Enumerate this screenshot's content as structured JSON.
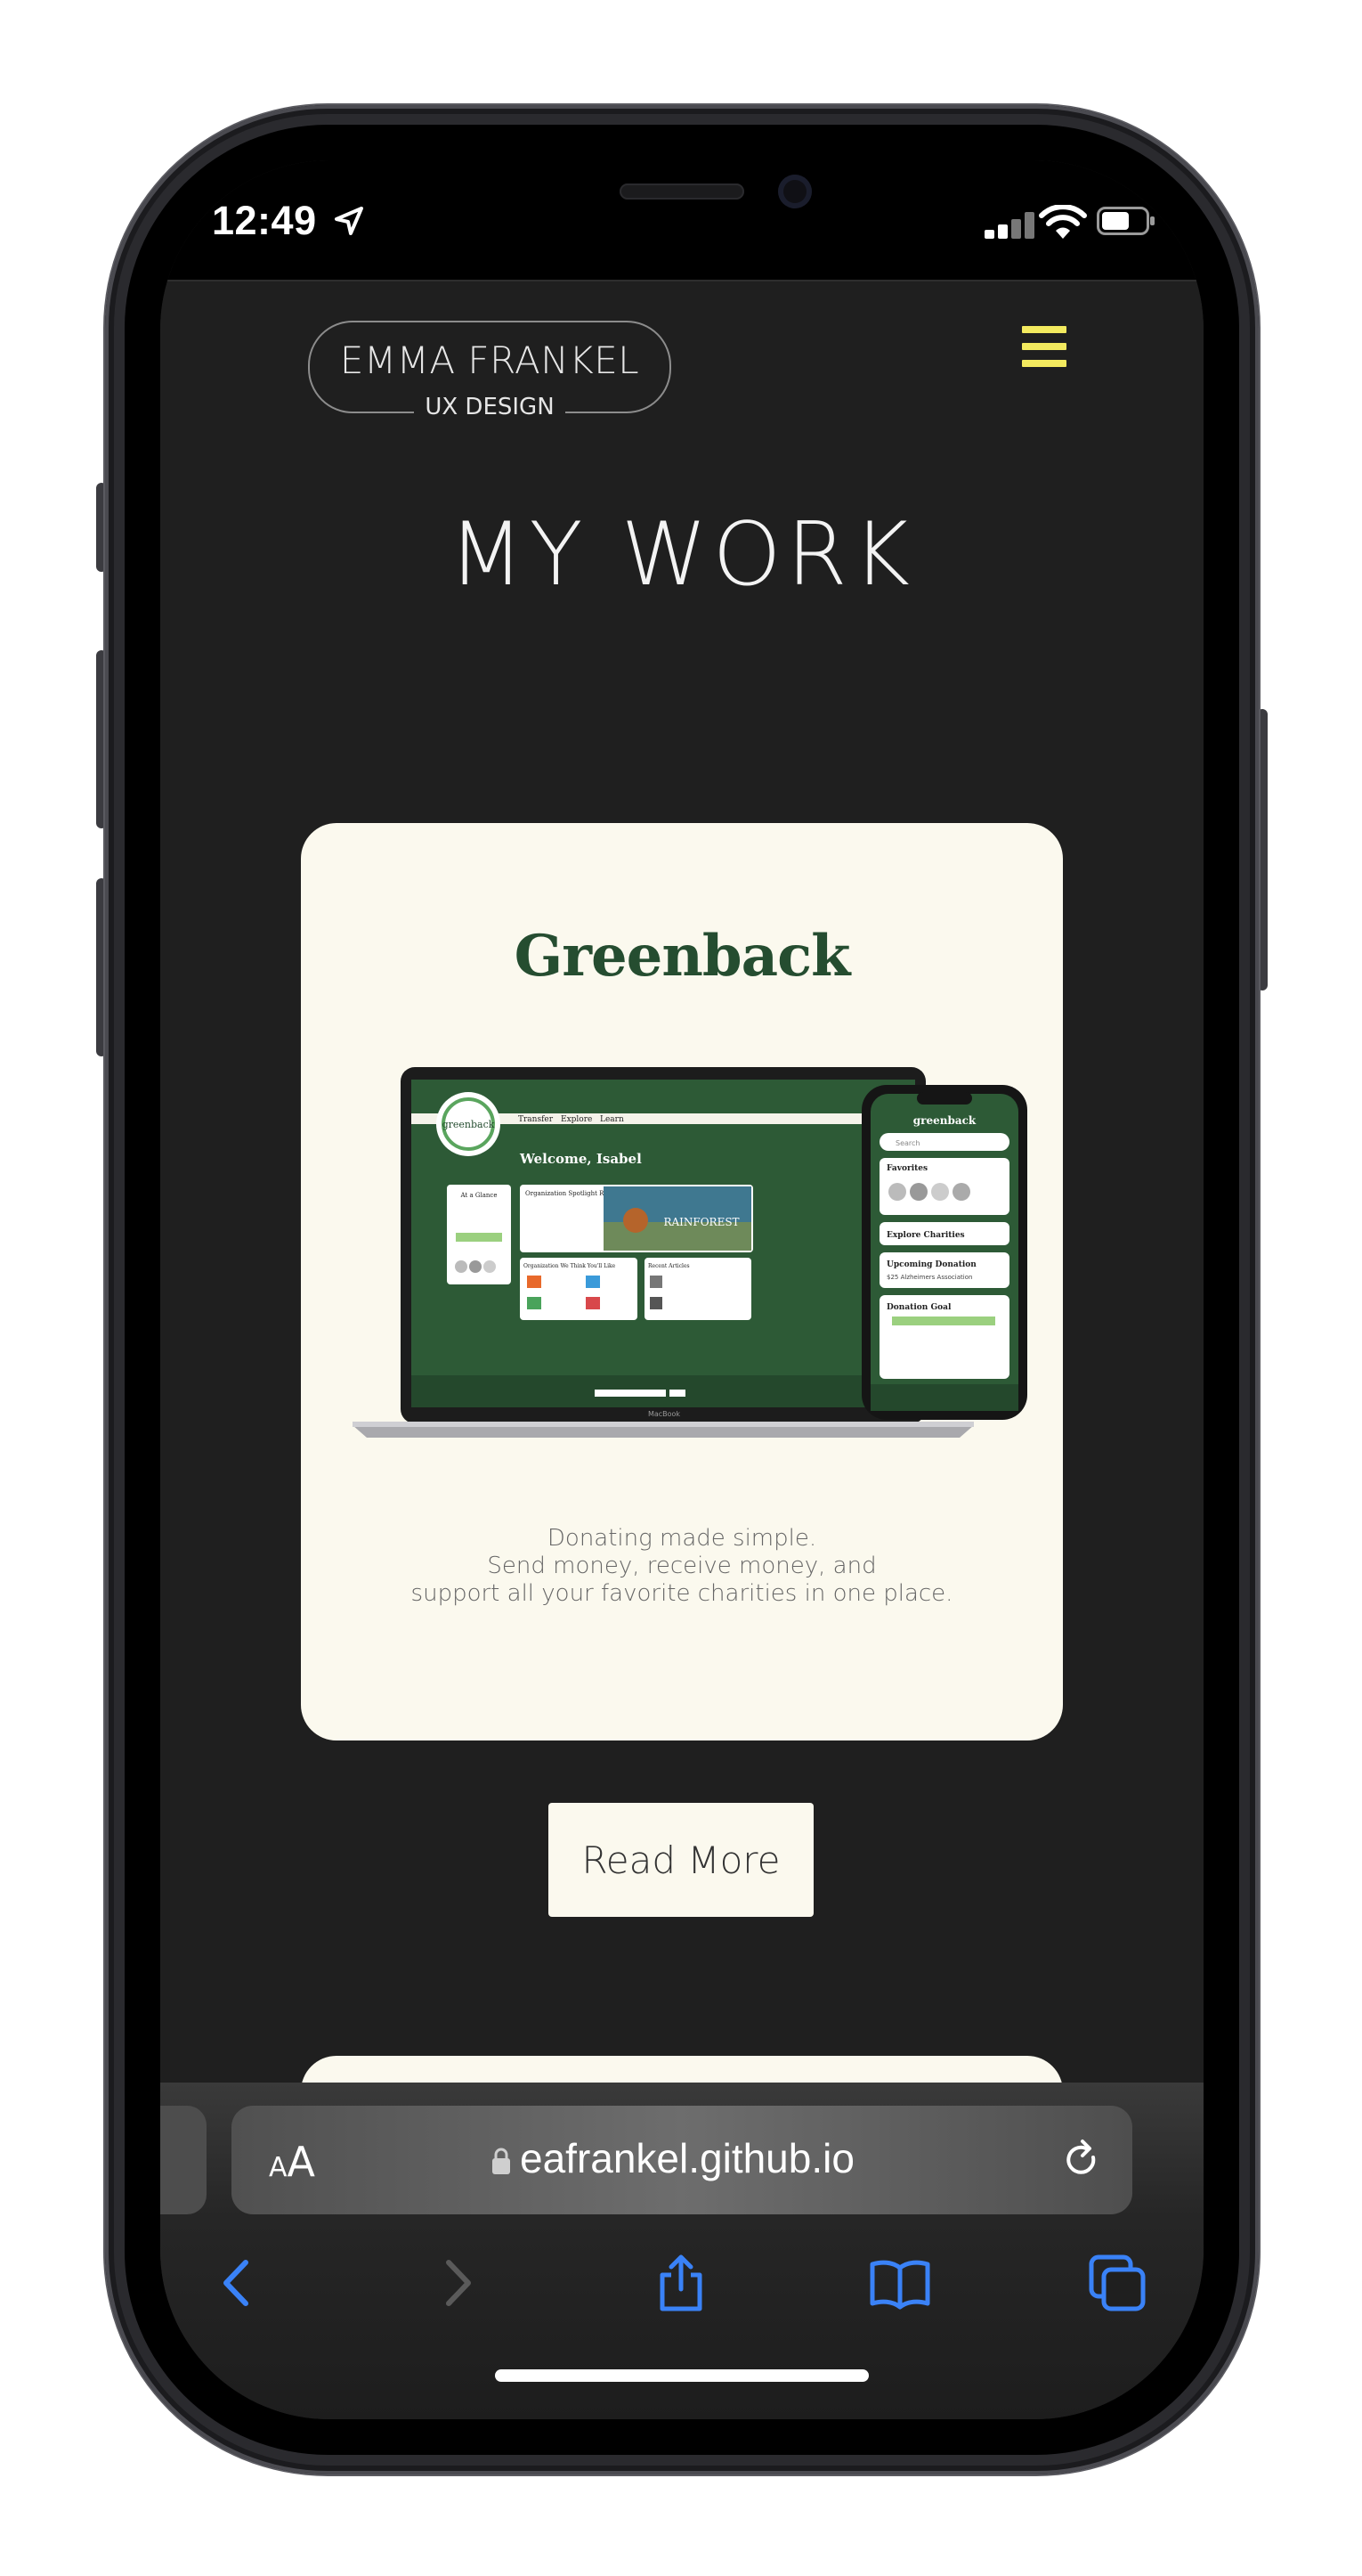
{
  "status_bar": {
    "time": "12:49"
  },
  "site": {
    "logo_name": "EMMA FRANKEL",
    "logo_sub": "UX DESIGN",
    "menu_icon": "hamburger-menu-icon",
    "menu_color": "#f3ea5f"
  },
  "main": {
    "heading": "MY WORK",
    "card": {
      "title": "Greenback",
      "description_lines": [
        "Donating made simple.",
        "Send money, receive money, and",
        "support all your favorite charities in one place."
      ],
      "mockup": {
        "brand": "greenback",
        "nav": [
          "Transfer",
          "Explore",
          "Learn"
        ],
        "welcome": "Welcome, Isabel",
        "glance": "At a Glance",
        "spotlight": "Organization Spotlight Rainforest Trust",
        "spot_image_text": "RAINFOREST",
        "orgs": "Organization We Think You'll Like",
        "articles": "Recent Articles",
        "laptop_label": "MacBook",
        "phone": {
          "search": "Search",
          "favorites": "Favorites",
          "explore": "Explore Charities",
          "upcoming": "Upcoming Donation",
          "upcoming_sub": "$25 Alzheimers Association",
          "goal": "Donation Goal"
        }
      }
    },
    "read_more": "Read More",
    "background": "#1f1f1f",
    "card_color": "#fbf9ee",
    "brand_green": "#254d30"
  },
  "safari": {
    "text_size_label": "A",
    "text_size_label_big": "A",
    "url": "eafrankel.github.io",
    "icons": [
      "back-icon",
      "forward-icon",
      "share-icon",
      "bookmarks-icon",
      "tabs-icon"
    ],
    "accent": "#3a82f7"
  }
}
